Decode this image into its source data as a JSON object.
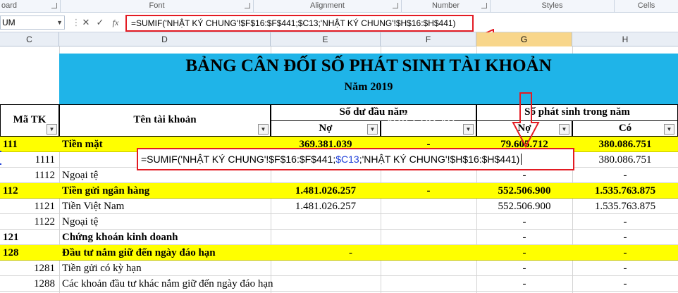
{
  "ribbon": {
    "groups": [
      {
        "label": "oard"
      },
      {
        "label": "Font"
      },
      {
        "label": "Alignment"
      },
      {
        "label": "Number"
      },
      {
        "label": "Styles"
      },
      {
        "label": "Cells"
      }
    ]
  },
  "formula_bar": {
    "name_box": "UM",
    "cancel_symbol": "✕",
    "enter_symbol": "✓",
    "fx_symbol": "fx",
    "formula": "=SUMIF('NHẬT KÝ CHUNG'!$F$16:$F$441;$C13;'NHẬT KÝ CHUNG'!$H$16:$H$441)"
  },
  "columns": [
    "C",
    "D",
    "E",
    "F",
    "G",
    "H"
  ],
  "sheet": {
    "title": "BẢNG CÂN ĐỐI SỐ PHÁT SINH TÀI KHOẢN",
    "subtitle": "Năm 2019",
    "watermark": "vaff.edu.vn",
    "headers": {
      "code": "Mã TK",
      "name": "Tên tài khoản",
      "opening": "Số dư đầu năm",
      "period": "Số phát sinh trong năm",
      "debit": "Nợ",
      "debit2": "Nợ",
      "credit": "Có"
    },
    "rows": [
      {
        "code": "111",
        "name": "Tiền mặt",
        "e": "369.381.039",
        "f": "-",
        "g": "79.605.712",
        "h": "380.086.751",
        "bold": true,
        "yellow": true
      },
      {
        "code": "1111",
        "name": "",
        "e": "",
        "f": "",
        "g": "",
        "h": "380.086.751",
        "bold": false,
        "yellow": false
      },
      {
        "code": "1112",
        "name": "Ngoại tệ",
        "e": "",
        "f": "",
        "g": "-",
        "h": "-",
        "bold": false,
        "yellow": false
      },
      {
        "code": "112",
        "name": "Tiền gửi ngân hàng",
        "e": "1.481.026.257",
        "f": "-",
        "g": "552.506.900",
        "h": "1.535.763.875",
        "bold": true,
        "yellow": true
      },
      {
        "code": "1121",
        "name": "Tiền Việt Nam",
        "e": "1.481.026.257",
        "f": "",
        "g": "552.506.900",
        "h": "1.535.763.875",
        "bold": false,
        "yellow": false
      },
      {
        "code": "1122",
        "name": "Ngoại tệ",
        "e": "",
        "f": "",
        "g": "-",
        "h": "-",
        "bold": false,
        "yellow": false
      },
      {
        "code": "121",
        "name": "Chứng khoán kinh doanh",
        "e": "",
        "f": "",
        "g": "-",
        "h": "-",
        "bold": true,
        "yellow": false
      },
      {
        "code": "128",
        "name": "Đầu tư nắm giữ đến ngày đáo hạn",
        "e": "-",
        "f": "",
        "g": "-",
        "h": "-",
        "bold": true,
        "yellow": true
      },
      {
        "code": "1281",
        "name": "Tiền gửi có kỳ hạn",
        "e": "",
        "f": "",
        "g": "-",
        "h": "-",
        "bold": false,
        "yellow": false
      },
      {
        "code": "1288",
        "name": "Các khoản đầu tư khác nắm giữ đến ngày đáo hạn",
        "e": "",
        "f": "",
        "g": "-",
        "h": "-",
        "bold": false,
        "yellow": false
      }
    ],
    "inline_formula": {
      "part1": "=SUMIF('NHẬT KÝ CHUNG'!$F$16:$F$441;",
      "ref": "$C13",
      "part2": ";'NHẬT KÝ CHUNG'!$H$16:$H$441)"
    }
  },
  "colors": {
    "title_band": "#1fb4e8",
    "highlight_row": "#ffff00",
    "annotation": "#e31b23",
    "reference": "#1f3fd8"
  }
}
